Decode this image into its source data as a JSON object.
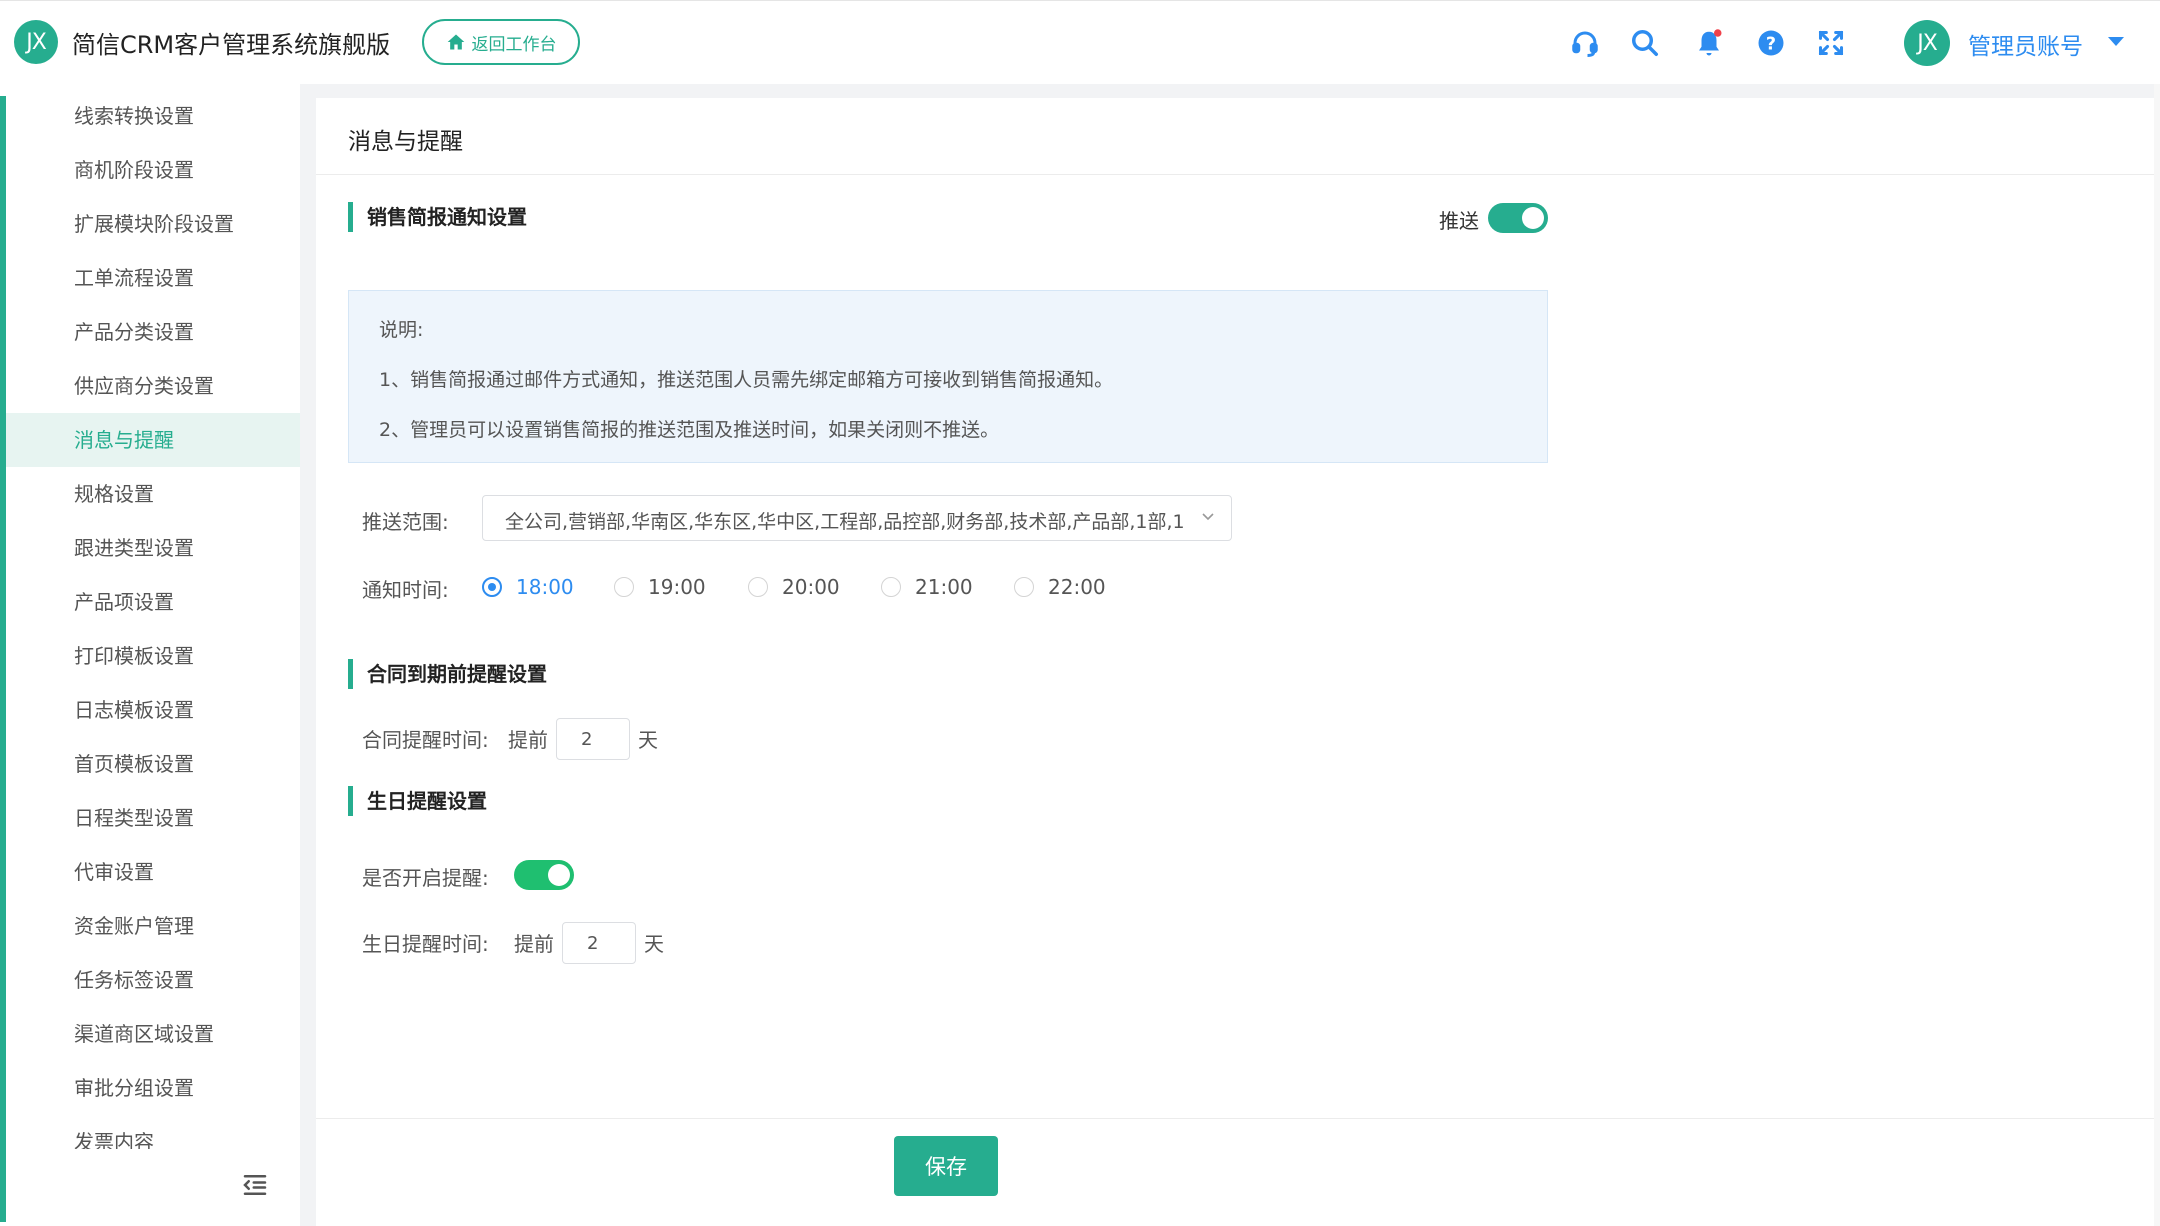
{
  "colors": {
    "brand": "#26ad8f",
    "link": "#2d8cf0",
    "toggle_on": "#1fbf70",
    "notice_bg": "#eef5fc"
  },
  "header": {
    "logo_text": "JX",
    "app_title": "简信CRM客户管理系统旗舰版",
    "back_button": "返回工作台",
    "icons": [
      "headset-icon",
      "search-icon",
      "bell-icon",
      "help-icon",
      "fullscreen-icon"
    ],
    "avatar_text": "JX",
    "user_name": "管理员账号"
  },
  "sidebar": {
    "items": [
      {
        "label": "线索转换设置"
      },
      {
        "label": "商机阶段设置"
      },
      {
        "label": "扩展模块阶段设置"
      },
      {
        "label": "工单流程设置"
      },
      {
        "label": "产品分类设置"
      },
      {
        "label": "供应商分类设置"
      },
      {
        "label": "消息与提醒",
        "active": true
      },
      {
        "label": "规格设置"
      },
      {
        "label": "跟进类型设置"
      },
      {
        "label": "产品项设置"
      },
      {
        "label": "打印模板设置"
      },
      {
        "label": "日志模板设置"
      },
      {
        "label": "首页模板设置"
      },
      {
        "label": "日程类型设置"
      },
      {
        "label": "代审设置"
      },
      {
        "label": "资金账户管理"
      },
      {
        "label": "任务标签设置"
      },
      {
        "label": "渠道商区域设置"
      },
      {
        "label": "审批分组设置"
      },
      {
        "label": "发票内容"
      }
    ]
  },
  "main": {
    "page_title": "消息与提醒",
    "sales_report": {
      "title": "销售简报通知设置",
      "push_label": "推送",
      "push_enabled": true,
      "notice": {
        "heading": "说明:",
        "line1": "1、销售简报通过邮件方式通知，推送范围人员需先绑定邮箱方可接收到销售简报通知。",
        "line2": "2、管理员可以设置销售简报的推送范围及推送时间，如果关闭则不推送。"
      },
      "scope_label": "推送范围:",
      "scope_value": "全公司,营销部,华南区,华东区,华中区,工程部,品控部,财务部,技术部,产品部,1部,1",
      "time_label": "通知时间:",
      "time_options": [
        "18:00",
        "19:00",
        "20:00",
        "21:00",
        "22:00"
      ],
      "selected_time": "18:00"
    },
    "contract": {
      "title": "合同到期前提醒设置",
      "label": "合同提醒时间:",
      "prefix": "提前",
      "days": "2",
      "unit": "天"
    },
    "birthday": {
      "title": "生日提醒设置",
      "enable_label": "是否开启提醒:",
      "enabled": true,
      "time_label": "生日提醒时间:",
      "prefix": "提前",
      "days": "2",
      "unit": "天"
    },
    "save_button": "保存"
  }
}
